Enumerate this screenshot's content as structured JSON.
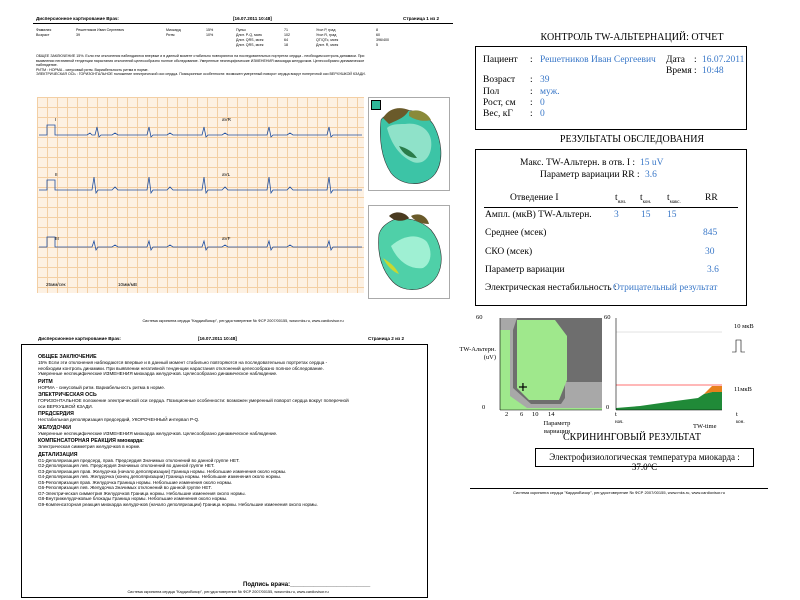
{
  "page1": {
    "header_title": "Дисперсионное картирование Врач:",
    "header_date": "[16.07.2011 10:48]",
    "header_page": "Страница 1 из 2",
    "patient_rows": [
      [
        "Фамилия",
        "Решетников Иван Сергеевич",
        "Миокард",
        "15%",
        "Пульс",
        "71",
        "Угол Р, град",
        "8"
      ],
      [
        "Возраст",
        "39",
        "Ритм",
        "10%",
        "Длит. P-Q, мсек",
        "102",
        "Угол R, град",
        "60"
      ],
      [
        "",
        "",
        "",
        "",
        "Длит. QRS, мсек",
        "64",
        "QT/QTc, мсек",
        "396/400"
      ],
      [
        "",
        "",
        "",
        "",
        "Длит. QRS, мсек",
        "18",
        "Длит. R, мсек",
        "5"
      ]
    ],
    "conclusion_lines": [
      "ОБЩЕЕ ЗАКЛЮЧЕНИЕ 15%. Если эти отклонения наблюдаются впервые и в данный момент стабильно повторяются на последовательных портретах сердца - необходим контроль динамики. При",
      "выявлении негативной тенденции нарастания отклонений целесообразно полное обследование. Умеренные неспецифические ИЗМЕНЕНИЯ миокарда желудочков. Целесообразно динамическое",
      "наблюдение.",
      "РИТМ : НОРМА - синусовый ритм. Вариабельность ритма в норме.",
      "ЭЛЕКТРИЧЕСКАЯ ОСЬ : ГОРИЗОНТАЛЬНОЕ положение электрической оси сердца. Позиционные особенности: возможен умеренный поворот сердца вокруг поперечной оси ВЕРХУШКОЙ КЗАДИ."
    ],
    "lead_labels": [
      "I",
      "aVR",
      "II",
      "aVL",
      "III",
      "aVF"
    ],
    "scale_speed": "25мм/сек",
    "scale_amp": "10мм/мВ",
    "footer": "Система скрининга сердца \"КардиоВизор\", рег.удостоверение № ФСР 2007/00155, www.mks.ru, www.cardiovisor.ru"
  },
  "page2": {
    "header_title": "Дисперсионное картирование Врач:",
    "header_date": "[16.07.2011 10:48]",
    "header_page": "Страница 2 из 2",
    "sections": [
      {
        "title": "ОБЩЕЕ ЗАКЛЮЧЕНИЕ",
        "lines": [
          "15% Если эти отклонения наблюдаются впервые и в данный момент стабильно повторяются на последовательных портретах сердца -",
          "необходим контроль динамики. При выявлении негативной тенденции нарастания отклонений целесообразно полное обследование.",
          "Умеренные неспецифические ИЗМЕНЕНИЯ миокарда желудочков. Целесообразно динамическое наблюдение."
        ]
      },
      {
        "title": "РИТМ",
        "lines": [
          "НОРМА - синусовый ритм. Вариабельность ритма в норме."
        ]
      },
      {
        "title": "ЭЛЕКТРИЧЕСКАЯ ОСЬ",
        "lines": [
          "ГОРИЗОНТАЛЬНОЕ положение электрической оси сердца. Позиционные особенности: возможен умеренный поворот сердца вокруг поперечной",
          "оси ВЕРХУШКОЙ КЗАДИ."
        ]
      },
      {
        "title": "ПРЕДСЕРДИЯ",
        "lines": [
          "Нестабильная деполяризация предсердий, УКОРОЧЕННЫЙ интервал P-Q."
        ]
      },
      {
        "title": "ЖЕЛУДОЧКИ",
        "lines": [
          "Умеренные неспецифические ИЗМЕНЕНИЯ миокарда желудочков. Целесообразно динамическое наблюдение."
        ]
      },
      {
        "title": "КОМПЕНСАТОРНАЯ РЕАКЦИЯ миокарда:",
        "lines": [
          "Электрическая симметрия желудочков в норме."
        ]
      },
      {
        "title": "ДЕТАЛИЗАЦИЯ",
        "lines": [
          "G1-Деполяризация предсерд. прав. Предсердия Значимых отклонений во данной группе НЕТ.",
          "G2-Деполяризация лев. Предсердия Значимых отклонений во данной группе НЕТ.",
          "G3-Деполяризация прав. Желудочка (начало деполяризации) Граница нормы. Небольшие изменения около нормы.",
          "G4-Деполяризация лев. Желудочка (конец деполяризации) Граница нормы. Небольшие изменения около нормы.",
          "G5-Реполяризация прав. Желудочка Граница нормы. Небольшие изменения около нормы.",
          "G6-Реполяризация лев. Желудочка Значимых отклонений во данной группе НЕТ.",
          "G7-Электрическая симметрия Желудочков Граница нормы. Небольшие изменения около нормы.",
          "G8-Внутрижелудочковые блокады Граница нормы. Небольшие изменения около нормы.",
          "G9-Компенсаторная реакция миокарда желудочков (начало деполяризации) Граница нормы. Небольшие изменения около нормы."
        ]
      }
    ],
    "signature": "Подпись врача:________________________",
    "footer": "Система скрининга сердца \"КардиоВизор\", рег.удостоверение № ФСР 2007/00155, www.mks.ru, www.cardiovisor.ru"
  },
  "report": {
    "title": "КОНТРОЛЬ TW-АЛЬТЕРНАЦИЙ: ОТЧЕТ",
    "patient_label": "Пациент",
    "patient_value": "Решетников Иван Сергеевич",
    "date_label": "Дата",
    "date_value": "16.07.2011",
    "time_label": "Время",
    "time_value": "10:48",
    "age_label": "Возраст",
    "age_value": "39",
    "sex_label": "Пол",
    "sex_value": "муж.",
    "height_label": "Рост, см",
    "height_value": "0",
    "weight_label": "Вес, кГ",
    "weight_value": "0",
    "colon": ":",
    "results_title": "РЕЗУЛЬТАТЫ ОБСЛЕДОВАНИЯ",
    "max_label": "Макс. TW-Альтерн. в отв. I :",
    "max_value": "15 uV",
    "var_label": "Параметр вариации RR :",
    "var_value": "3.6",
    "col_lead": "Отведение I",
    "col_tnach": "t",
    "col_tnach_sub": "нач.",
    "col_tkon": "t",
    "col_tkon_sub": "кон.",
    "col_tmax": "t",
    "col_tmax_sub": "макс.",
    "col_rr": "RR",
    "amp_label": "Ампл. (мкВ) TW-Альтерн.",
    "amp_vals": [
      "3",
      "15",
      "15"
    ],
    "mean_label": "Среднее (мсек)",
    "mean_value": "845",
    "sko_label": "СКО (мсек)",
    "sko_value": "30",
    "param_label": "Параметр вариации",
    "param_value": "3.6",
    "instab_label": "Электрическая нестабильность :",
    "instab_value": "Отрицательный результат",
    "screening_title": "СКРИНИНГОВЫЙ РЕЗУЛЬТАТ",
    "temp_text": "Электрофизиологическая температура миокарда : 37.0°С",
    "footer": "Система скрининга сердца \"КардиоВизор\", рег.удостоверение № ФСР 2007/00155, www.mks.ru, www.cardiovisor.ru"
  },
  "chart_data": [
    {
      "type": "area",
      "ylabel": "TW-Альтерн. (uV)",
      "xlabel": "Параметр вариации",
      "y_ticks": [
        "60",
        "0"
      ],
      "x_ticks": [
        "2",
        "6",
        "10",
        "14"
      ],
      "marker": {
        "x": 3.6,
        "y": 15
      }
    },
    {
      "type": "area",
      "y_ticks": [
        "60",
        "0"
      ],
      "x_tick_start": "t",
      "x_tick_start_sub": "нач.",
      "x_tick_end": "t",
      "x_tick_end_sub": "кон.",
      "xlabel": "TW-time",
      "scale_label": "10 мкВ",
      "level_label": "11мкВ",
      "colors": {
        "green": "#2a8a3a",
        "orange": "#e8801c",
        "red": "#d22"
      }
    }
  ]
}
